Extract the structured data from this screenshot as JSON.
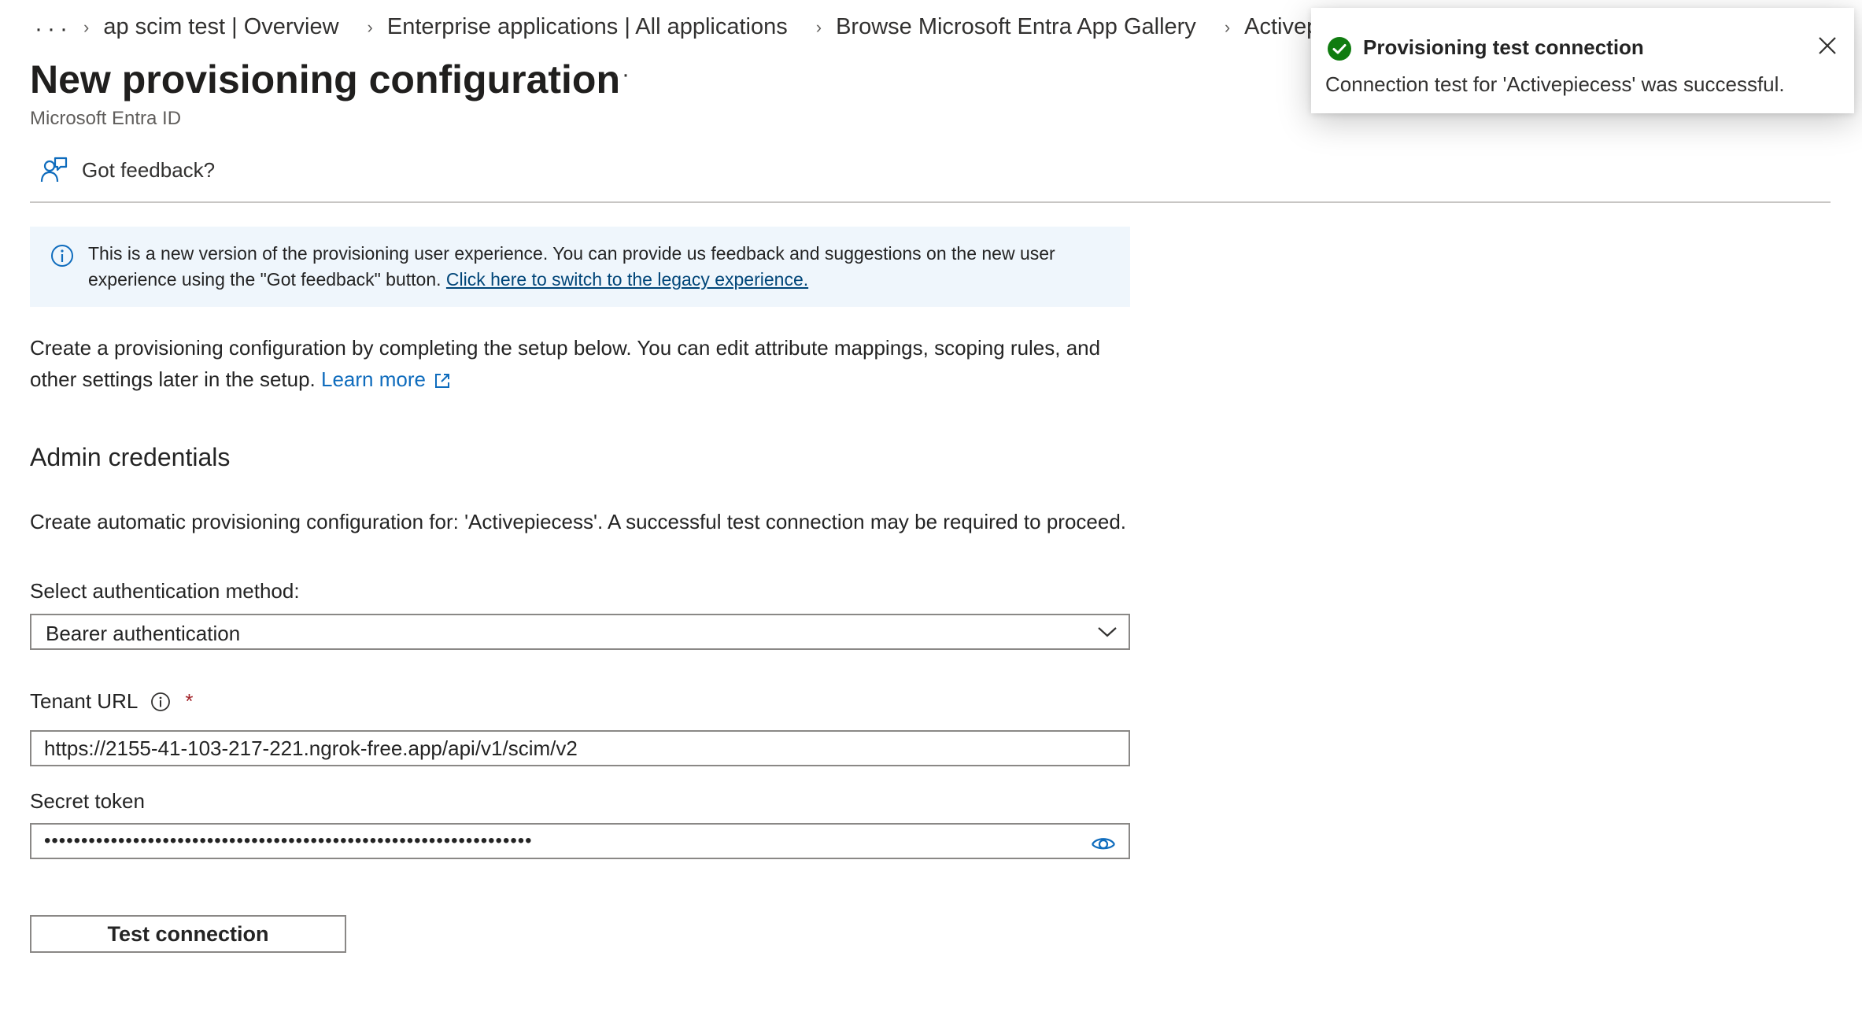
{
  "breadcrumb": {
    "ellipsis": "···",
    "items": [
      {
        "label": "ap scim test | Overview"
      },
      {
        "label": "Enterprise applications | All applications"
      },
      {
        "label": "Browse Microsoft Entra App Gallery"
      },
      {
        "label": "Activepiecess"
      }
    ]
  },
  "header": {
    "title": "New provisioning configuration",
    "more": "···",
    "subtitle": "Microsoft Entra ID"
  },
  "toolbar": {
    "feedback_label": "Got feedback?"
  },
  "banner": {
    "text": "This is a new version of the provisioning user experience. You can provide us feedback and suggestions on the new user experience using the \"Got feedback\" button. ",
    "link": "Click here to switch to the legacy experience."
  },
  "intro": {
    "text": "Create a provisioning configuration by completing the setup below. You can edit attribute mappings, scoping rules, and other settings later in the setup. ",
    "link": "Learn more"
  },
  "admin": {
    "heading": "Admin credentials",
    "description": "Create automatic provisioning configuration for: 'Activepiecess'. A successful test connection may be required to proceed."
  },
  "form": {
    "auth_label": "Select authentication method:",
    "auth_value": "Bearer authentication",
    "tenant_label": "Tenant URL",
    "tenant_required": "*",
    "tenant_value": "https://2155-41-103-217-221.ngrok-free.app/api/v1/scim/v2",
    "secret_label": "Secret token",
    "secret_value": "••••••••••••••••••••••••••••••••••••••••••••••••••••••••••••••••••",
    "test_button": "Test connection"
  },
  "toast": {
    "title": "Provisioning test connection",
    "message": "Connection test for 'Activepiecess' was successful.",
    "status": "success"
  },
  "colors": {
    "accent": "#0f6cbd",
    "success": "#107c10",
    "banner_bg": "#eff6fc",
    "required": "#a4262c"
  },
  "icons": {
    "feedback": "person-feedback-icon",
    "info": "info-icon",
    "external": "open-external-icon",
    "chevron": "chevron-down-icon",
    "eye": "eye-icon",
    "success": "checkmark-circle-icon",
    "close": "close-icon"
  }
}
